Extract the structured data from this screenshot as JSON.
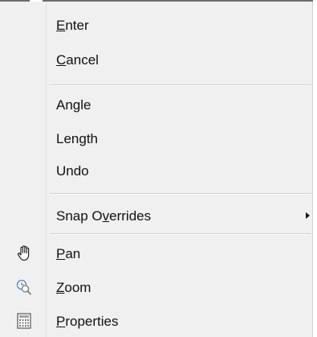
{
  "menu": {
    "items": [
      {
        "id": "enter",
        "pre": "",
        "u": "E",
        "post": "nter"
      },
      {
        "id": "cancel",
        "pre": "",
        "u": "C",
        "post": "ancel"
      },
      {
        "id": "angle",
        "pre": "Angle",
        "u": "",
        "post": ""
      },
      {
        "id": "length",
        "pre": "Length",
        "u": "",
        "post": ""
      },
      {
        "id": "undo",
        "pre": "Undo",
        "u": "",
        "post": ""
      },
      {
        "id": "snap-overrides",
        "pre": "Snap O",
        "u": "v",
        "post": "errides",
        "submenu": true
      },
      {
        "id": "pan",
        "pre": "",
        "u": "P",
        "post": "an",
        "icon": "hand-pan-icon"
      },
      {
        "id": "zoom",
        "pre": "",
        "u": "Z",
        "post": "oom",
        "icon": "zoom-magnifier-clock-icon"
      },
      {
        "id": "properties",
        "pre": "",
        "u": "P",
        "post": "roperties",
        "icon": "properties-grid-icon"
      }
    ]
  }
}
